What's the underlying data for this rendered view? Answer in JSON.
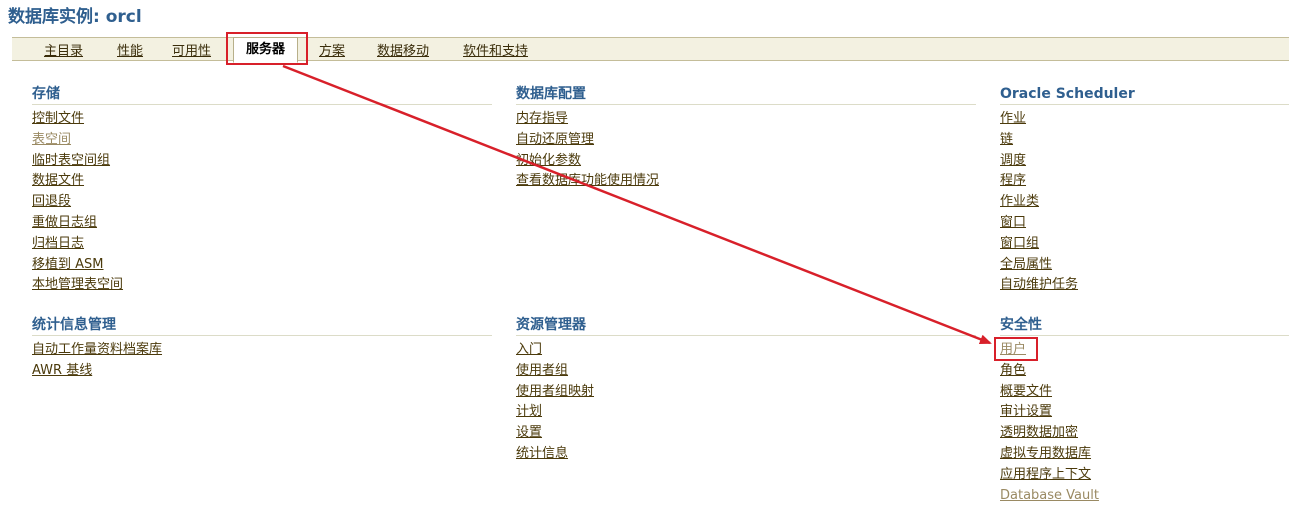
{
  "page": {
    "title": "数据库实例: orcl"
  },
  "tabs": [
    {
      "label": "主目录"
    },
    {
      "label": "性能"
    },
    {
      "label": "可用性"
    },
    {
      "label": "服务器",
      "active": true
    },
    {
      "label": "方案"
    },
    {
      "label": "数据移动"
    },
    {
      "label": "软件和支持"
    }
  ],
  "sections": {
    "storage": {
      "title": "存储",
      "links": [
        "控制文件",
        "表空间",
        "临时表空间组",
        "数据文件",
        "回退段",
        "重做日志组",
        "归档日志",
        "移植到 ASM",
        "本地管理表空间"
      ]
    },
    "db_config": {
      "title": "数据库配置",
      "links": [
        "内存指导",
        "自动还原管理",
        "初始化参数",
        "查看数据库功能使用情况"
      ]
    },
    "scheduler": {
      "title": "Oracle Scheduler",
      "links": [
        "作业",
        "链",
        "调度",
        "程序",
        "作业类",
        "窗口",
        "窗口组",
        "全局属性",
        "自动维护任务"
      ]
    },
    "stats": {
      "title": "统计信息管理",
      "links": [
        "自动工作量资料档案库",
        "AWR 基线"
      ]
    },
    "resource_manager": {
      "title": "资源管理器",
      "links": [
        "入门",
        "使用者组",
        "使用者组映射",
        "计划",
        "设置",
        "统计信息"
      ]
    },
    "security": {
      "title": "安全性",
      "links": [
        "用户",
        "角色",
        "概要文件",
        "审计设置",
        "透明数据加密",
        "虚拟专用数据库",
        "应用程序上下文",
        "Database Vault"
      ]
    }
  },
  "annotation": {
    "color": "#d8202a"
  }
}
